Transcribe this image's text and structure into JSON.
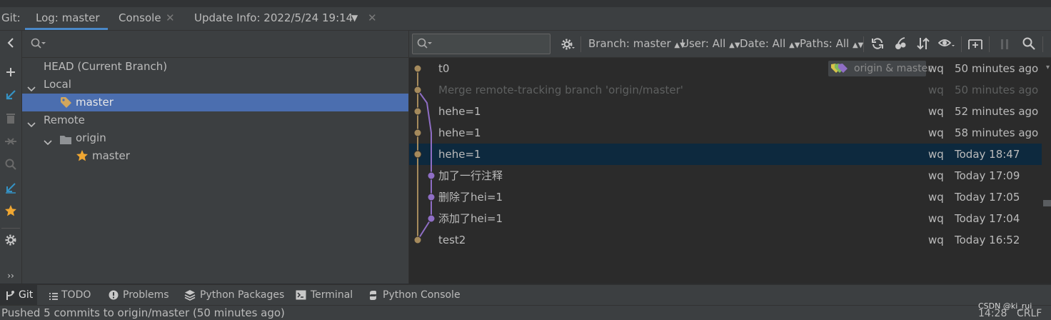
{
  "tabbar": {
    "prefix": "Git:",
    "tabs": [
      {
        "label": "Log: master",
        "active": true
      },
      {
        "label": "Console",
        "closable": true
      },
      {
        "label": "Update Info: 2022/5/24 19:14",
        "closable": true,
        "dropdown": true
      }
    ]
  },
  "left_toolbar": {
    "icons": [
      "collapse-panel-icon",
      "add-icon",
      "update-icon",
      "delete-icon",
      "merge-icon",
      "search-icon",
      "pull-icon",
      "favorite-icon",
      "settings-icon",
      "more-icon"
    ]
  },
  "branches": {
    "search_placeholder": "",
    "tree": [
      {
        "label": "HEAD (Current Branch)",
        "level": 0,
        "expander": "none"
      },
      {
        "label": "Local",
        "level": 0,
        "expander": "open"
      },
      {
        "label": "master",
        "level": 1,
        "icon": "tag-icon",
        "selected": true
      },
      {
        "label": "Remote",
        "level": 0,
        "expander": "open"
      },
      {
        "label": "origin",
        "level": 1,
        "expander": "open",
        "icon": "folder-icon"
      },
      {
        "label": "master",
        "level": 2,
        "icon": "star-icon"
      }
    ]
  },
  "log_toolbar": {
    "search_placeholder": "",
    "filters": [
      {
        "label": "Branch: master"
      },
      {
        "label": "User: All"
      },
      {
        "label": "Date: All"
      },
      {
        "label": "Paths: All"
      }
    ],
    "icons": [
      "refresh-icon",
      "cherry-pick-icon",
      "sort-icon",
      "eye-icon",
      "new-tab-icon",
      "pause-icon",
      "search-icon"
    ]
  },
  "commits": [
    {
      "subject": "t0",
      "author": "wq",
      "date": "50 minutes ago",
      "tag": "origin & master"
    },
    {
      "subject": "Merge remote-tracking branch 'origin/master'",
      "author": "wq",
      "date": "50 minutes ago",
      "dim": true
    },
    {
      "subject": "hehe=1",
      "author": "wq",
      "date": "52 minutes ago"
    },
    {
      "subject": "hehe=1",
      "author": "wq",
      "date": "58 minutes ago"
    },
    {
      "subject": "hehe=1",
      "author": "wq",
      "date": "Today 18:47",
      "selected": true
    },
    {
      "subject": "加了一行注释",
      "author": "wq",
      "date": "Today 17:09"
    },
    {
      "subject": "删除了hei=1",
      "author": "wq",
      "date": "Today 17:05"
    },
    {
      "subject": "添加了hei=1",
      "author": "wq",
      "date": "Today 17:04"
    },
    {
      "subject": "test2",
      "author": "wq",
      "date": "Today 16:52"
    }
  ],
  "graph_colors": {
    "main": "#a58a5c",
    "branch": "#8f6ec5"
  },
  "bottom_tabs": [
    {
      "label": "Git",
      "icon": "git-icon",
      "active": true
    },
    {
      "label": "TODO",
      "icon": "list-icon"
    },
    {
      "label": "Problems",
      "icon": "problems-icon"
    },
    {
      "label": "Python Packages",
      "icon": "packages-icon"
    },
    {
      "label": "Terminal",
      "icon": "terminal-icon"
    },
    {
      "label": "Python Console",
      "icon": "python-icon"
    }
  ],
  "status": {
    "message": "Pushed 5 commits to origin/master (50 minutes ago)",
    "watermark": "CSDN @ki_rui",
    "time": "14:28",
    "line_ending": "CRLF"
  }
}
